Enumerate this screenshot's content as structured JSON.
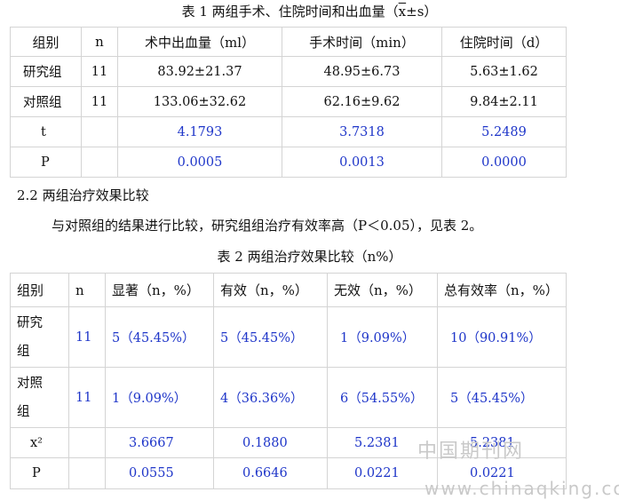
{
  "table1": {
    "caption_prefix": "表 1 两组手术、住院时间和出血量（",
    "caption_xbar": "x",
    "caption_suffix": "±s）",
    "headers": [
      "组别",
      "n",
      "术中出血量（ml）",
      "手术时间（min）",
      "住院时间（d）"
    ],
    "rows": [
      [
        "研究组",
        "11",
        "83.92±21.37",
        "48.95±6.73",
        "5.63±1.62"
      ],
      [
        "对照组",
        "11",
        "133.06±32.62",
        "62.16±9.62",
        "9.84±2.11"
      ],
      [
        "t",
        "",
        "4.1793",
        "3.7318",
        "5.2489"
      ],
      [
        "P",
        "",
        "0.0005",
        "0.0013",
        "0.0000"
      ]
    ]
  },
  "section_heading": "2.2  两组治疗效果比较",
  "paragraph": "与对照组的结果进行比较，研究组组治疗有效率高（P＜0.05），见表 2。",
  "table2": {
    "caption": "表 2 两组治疗效果比较（n%）",
    "headers": [
      "组别",
      "n",
      "显著（n，%）",
      "有效（n，%）",
      "无效（n，%）",
      "总有效率（n，%）"
    ],
    "row_research": [
      "研究",
      "组",
      "11",
      "5（45.45%）",
      "5（45.45%）",
      "1（9.09%）",
      "10（90.91%）"
    ],
    "row_control": [
      "对照",
      "组",
      "11",
      "1（9.09%）",
      "4（36.36%）",
      "6（54.55%）",
      "5（45.45%）"
    ],
    "row_chi": [
      "x²",
      "3.6667",
      "0.1880",
      "5.2381",
      "5.2381"
    ],
    "row_p": [
      "P",
      "0.0555",
      "0.6646",
      "0.0221",
      "0.0221"
    ]
  },
  "watermark": {
    "cn": "中国期刊网",
    "url": "www.chinaqking.com"
  },
  "colors": {
    "value_text": "#1f36c9",
    "border": "#d4d4d4",
    "watermark": "#c9c9c9"
  }
}
